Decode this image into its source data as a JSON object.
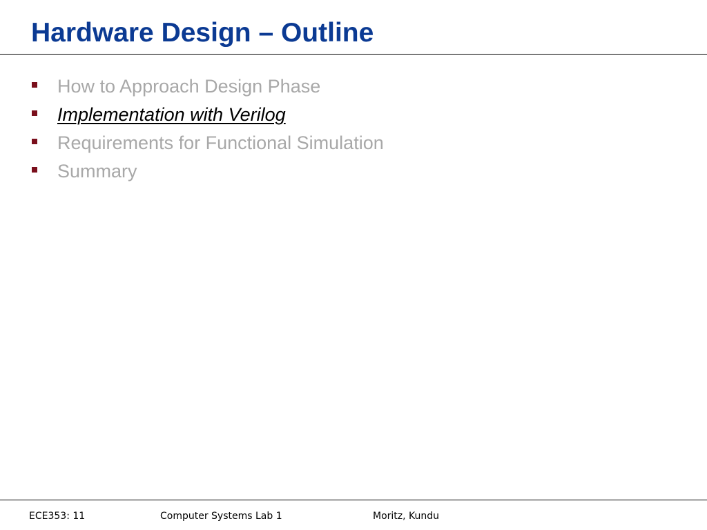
{
  "slide": {
    "title": "Hardware Design – Outline",
    "bullets": [
      {
        "text": "How to Approach Design Phase",
        "state": "dim"
      },
      {
        "text": "Implementation with Verilog",
        "state": "current"
      },
      {
        "text": "Requirements for Functional Simulation",
        "state": "dim"
      },
      {
        "text": "Summary",
        "state": "dim"
      }
    ]
  },
  "footer": {
    "left": "ECE353: 11",
    "center": "Computer Systems Lab 1",
    "right": "Moritz, Kundu"
  },
  "colors": {
    "title": "#0b3a93",
    "bullet_marker": "#7a0f1c",
    "dim_text": "#a8a8a8",
    "current_text": "#000000"
  }
}
